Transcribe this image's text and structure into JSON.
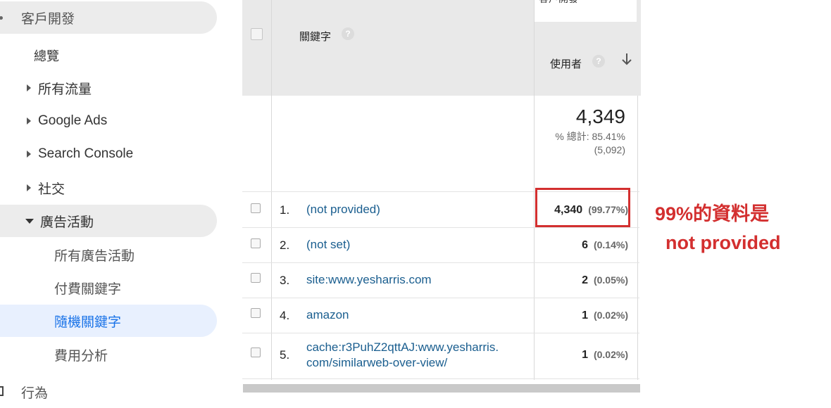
{
  "sidebar": {
    "items": [
      {
        "label": "客戶開發"
      },
      {
        "label": "總覽"
      },
      {
        "label": "所有流量"
      },
      {
        "label": "Google Ads"
      },
      {
        "label": "Search Console"
      },
      {
        "label": "社交"
      },
      {
        "label": "廣告活動"
      },
      {
        "label": "所有廣告活動"
      },
      {
        "label": "付費關鍵字"
      },
      {
        "label": "隨機關鍵字"
      },
      {
        "label": "費用分析"
      },
      {
        "label": "行為"
      }
    ]
  },
  "table": {
    "top_partial_header": "客戶開發",
    "columns": {
      "keyword": "關鍵字",
      "users": "使用者"
    },
    "totals": {
      "value": "4,349",
      "pct_line": "% 總計: 85.41%",
      "abs_line": "(5,092)"
    },
    "rows": [
      {
        "index": "1.",
        "keyword": "(not provided)",
        "value": "4,340",
        "pct": "(99.77%)"
      },
      {
        "index": "2.",
        "keyword": "(not set)",
        "value": "6",
        "pct": "(0.14%)"
      },
      {
        "index": "3.",
        "keyword": "site:www.yesharris.com",
        "value": "2",
        "pct": "(0.05%)"
      },
      {
        "index": "4.",
        "keyword": "amazon",
        "value": "1",
        "pct": "(0.02%)"
      },
      {
        "index": "5.",
        "keyword_line1": "cache:r3PuhZ2qttAJ:www.yesharris.",
        "keyword_line2": "com/similarweb-over-view/",
        "value": "1",
        "pct": "(0.02%)"
      }
    ]
  },
  "annotation": {
    "line1": "99%的資料是",
    "line2": "not provided",
    "color": "#d32f2f"
  },
  "colors": {
    "link": "#1a5e8f",
    "active_nav": "#1a73e8",
    "header_band": "#e9e9e9"
  }
}
